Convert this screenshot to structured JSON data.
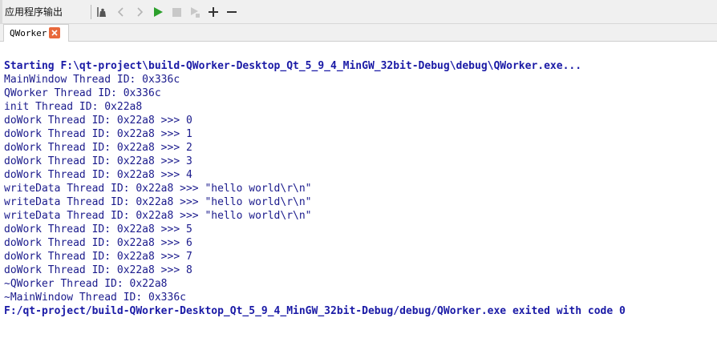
{
  "toolbar": {
    "pane_title": "应用程序输出"
  },
  "tabs": [
    {
      "label": "QWorker"
    }
  ],
  "output": {
    "lines": [
      {
        "text": "Starting F:\\qt-project\\build-QWorker-Desktop_Qt_5_9_4_MinGW_32bit-Debug\\debug\\QWorker.exe...",
        "kind": "status"
      },
      {
        "text": "MainWindow Thread ID: 0x336c",
        "kind": "info"
      },
      {
        "text": "QWorker Thread ID: 0x336c",
        "kind": "info"
      },
      {
        "text": "init Thread ID: 0x22a8",
        "kind": "info"
      },
      {
        "text": "doWork Thread ID: 0x22a8 >>> 0",
        "kind": "info"
      },
      {
        "text": "doWork Thread ID: 0x22a8 >>> 1",
        "kind": "info"
      },
      {
        "text": "doWork Thread ID: 0x22a8 >>> 2",
        "kind": "info"
      },
      {
        "text": "doWork Thread ID: 0x22a8 >>> 3",
        "kind": "info"
      },
      {
        "text": "doWork Thread ID: 0x22a8 >>> 4",
        "kind": "info"
      },
      {
        "text": "writeData Thread ID: 0x22a8 >>> \"hello world\\r\\n\"",
        "kind": "info"
      },
      {
        "text": "writeData Thread ID: 0x22a8 >>> \"hello world\\r\\n\"",
        "kind": "info"
      },
      {
        "text": "writeData Thread ID: 0x22a8 >>> \"hello world\\r\\n\"",
        "kind": "info"
      },
      {
        "text": "doWork Thread ID: 0x22a8 >>> 5",
        "kind": "info"
      },
      {
        "text": "doWork Thread ID: 0x22a8 >>> 6",
        "kind": "info"
      },
      {
        "text": "doWork Thread ID: 0x22a8 >>> 7",
        "kind": "info"
      },
      {
        "text": "doWork Thread ID: 0x22a8 >>> 8",
        "kind": "info"
      },
      {
        "text": "~QWorker Thread ID: 0x22a8",
        "kind": "info"
      },
      {
        "text": "~MainWindow Thread ID: 0x336c",
        "kind": "info"
      },
      {
        "text": "F:/qt-project/build-QWorker-Desktop_Qt_5_9_4_MinGW_32bit-Debug/debug/QWorker.exe exited with code 0",
        "kind": "status"
      }
    ]
  },
  "colors": {
    "info_text": "#1a1a8c",
    "status_text": "#1a1aa6",
    "run_green": "#2ca02c",
    "tab_close": "#e8693c"
  },
  "icons": [
    "attach-debugger-icon",
    "previous-item-icon",
    "next-item-icon",
    "run-icon",
    "stop-icon",
    "rerun-icon",
    "zoom-in-icon",
    "zoom-out-icon",
    "tab-close-icon"
  ]
}
